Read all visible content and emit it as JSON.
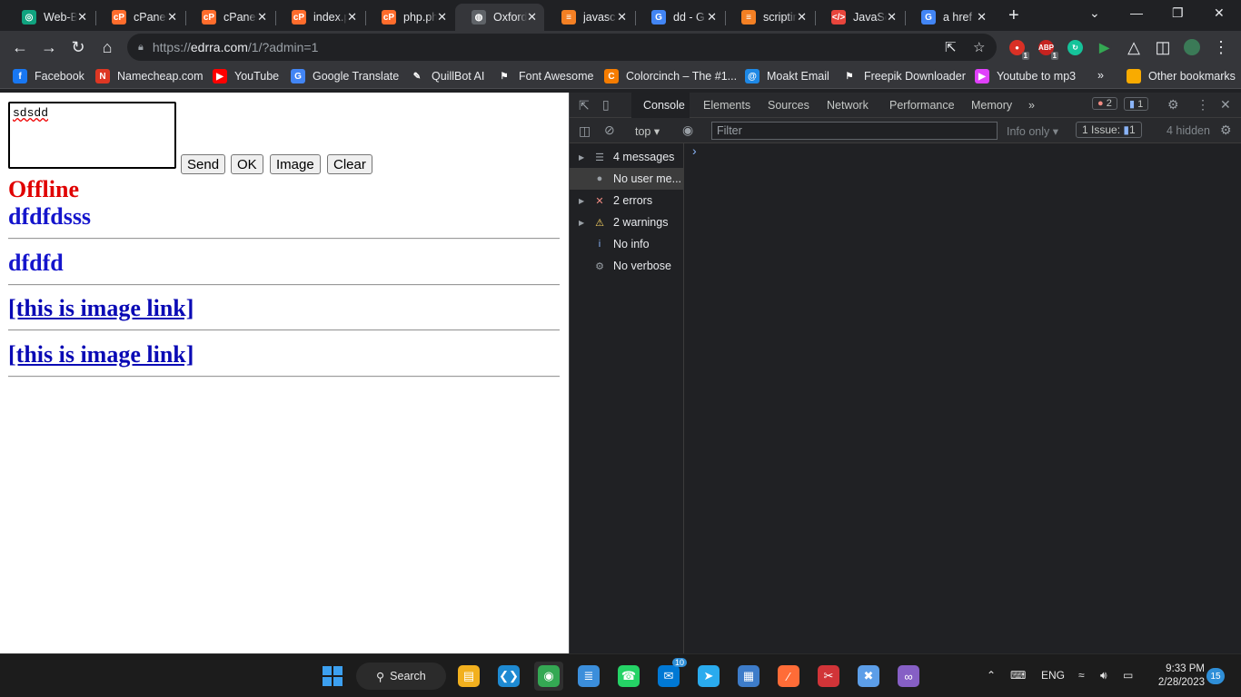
{
  "browser": {
    "tabs": [
      {
        "title": "Web-B",
        "favicon": "openai-favicon",
        "color": "#10a37f",
        "glyph": "◎"
      },
      {
        "title": "cPanel",
        "favicon": "cpanel-favicon",
        "color": "#ff6c2c",
        "glyph": "cP"
      },
      {
        "title": "cPanel",
        "favicon": "cpanel-favicon",
        "color": "#ff6c2c",
        "glyph": "cP"
      },
      {
        "title": "index.p",
        "favicon": "cpanel-favicon",
        "color": "#ff6c2c",
        "glyph": "cP"
      },
      {
        "title": "php.ph",
        "favicon": "cpanel-favicon",
        "color": "#ff6c2c",
        "glyph": "cP"
      },
      {
        "title": "Oxford",
        "favicon": "globe-favicon",
        "color": "#5f6368",
        "glyph": "◍"
      },
      {
        "title": "javasc",
        "favicon": "stackoverflow-favicon",
        "color": "#f48024",
        "glyph": "≡"
      },
      {
        "title": "dd - G",
        "favicon": "google-favicon",
        "color": "#4285f4",
        "glyph": "G"
      },
      {
        "title": "scriptin",
        "favicon": "stackoverflow-favicon",
        "color": "#f48024",
        "glyph": "≡"
      },
      {
        "title": "JavaSc",
        "favicon": "code-favicon",
        "color": "#e8453c",
        "glyph": "</>"
      },
      {
        "title": "a href",
        "favicon": "google-favicon",
        "color": "#4285f4",
        "glyph": "G"
      }
    ],
    "active_tab": 5,
    "url_prefix": "https://",
    "url_host": "edrra.com",
    "url_path": "/1/?admin=1",
    "extensions": [
      {
        "name": "extension-red-icon",
        "color": "#d93025",
        "glyph": "●",
        "badge": "1"
      },
      {
        "name": "adblock-icon",
        "color": "#c5221f",
        "glyph": "ABP",
        "badge": "1"
      },
      {
        "name": "grammarly-icon",
        "color": "#15c39a",
        "glyph": "↻",
        "badge": ""
      },
      {
        "name": "send-extension-icon",
        "color": "#35363a",
        "glyph": "▶",
        "badge": ""
      }
    ],
    "bookmarks": [
      {
        "label": "Facebook",
        "icon": "facebook-icon",
        "color": "#1877f2",
        "glyph": "f"
      },
      {
        "label": "Namecheap.com",
        "icon": "namecheap-icon",
        "color": "#de3723",
        "glyph": "N"
      },
      {
        "label": "YouTube",
        "icon": "youtube-icon",
        "color": "#ff0000",
        "glyph": "▶"
      },
      {
        "label": "Google Translate",
        "icon": "google-translate-icon",
        "color": "#4285f4",
        "glyph": "G"
      },
      {
        "label": "QuillBot AI",
        "icon": "quillbot-icon",
        "color": "#35363a",
        "glyph": "✎"
      },
      {
        "label": "Font Awesome",
        "icon": "flag-icon",
        "color": "#35363a",
        "glyph": "⚑"
      },
      {
        "label": "Colorcinch – The #1...",
        "icon": "colorcinch-icon",
        "color": "#f57c00",
        "glyph": "C"
      },
      {
        "label": "Moakt Email",
        "icon": "moakt-icon",
        "color": "#1e88e5",
        "glyph": "@"
      },
      {
        "label": "Freepik Downloader",
        "icon": "freepik-icon",
        "color": "#35363a",
        "glyph": "⚑"
      },
      {
        "label": "Youtube to mp3",
        "icon": "yt-mp3-icon",
        "color": "#e040fb",
        "glyph": "▶"
      }
    ],
    "overflow": "»",
    "other_bookmarks": "Other bookmarks"
  },
  "page": {
    "textarea_value": "sdsdd",
    "buttons": {
      "send": "Send",
      "ok": "OK",
      "image": "Image",
      "clear": "Clear"
    },
    "status": "Offline",
    "posts": [
      "dfdfdsss",
      "dfdfd"
    ],
    "links": [
      "[this is image link]",
      "[this is image link]"
    ]
  },
  "devtools": {
    "tabs": [
      "Console",
      "Elements",
      "Sources",
      "Network",
      "Performance",
      "Memory"
    ],
    "more": "»",
    "errors_badge": "2",
    "issues_badge": "1",
    "context": "top",
    "filter_placeholder": "Filter",
    "levels": "Info only",
    "issues_label": "1 Issue:",
    "issues_count": "1",
    "hidden": "4 hidden",
    "prompt": "›",
    "sidebar": [
      {
        "label": "4 messages",
        "icon": "list-icon",
        "glyph": "☰",
        "color": "#9aa0a6",
        "expandable": true
      },
      {
        "label": "No user me...",
        "icon": "user-icon",
        "glyph": "●",
        "color": "#9aa0a6",
        "expandable": false
      },
      {
        "label": "2 errors",
        "icon": "error-icon",
        "glyph": "✕",
        "color": "#f28b82",
        "expandable": true
      },
      {
        "label": "2 warnings",
        "icon": "warning-icon",
        "glyph": "⚠",
        "color": "#fdd663",
        "expandable": true
      },
      {
        "label": "No info",
        "icon": "info-icon",
        "glyph": "i",
        "color": "#8ab4f8",
        "expandable": false
      },
      {
        "label": "No verbose",
        "icon": "bug-icon",
        "glyph": "⚙",
        "color": "#9aa0a6",
        "expandable": false
      }
    ],
    "selected_sidebar": 1
  },
  "taskbar": {
    "search_label": "Search",
    "apps": [
      {
        "name": "file-explorer-icon",
        "color": "#f2b01e",
        "glyph": "▤"
      },
      {
        "name": "vscode-icon",
        "color": "#1e8ad2",
        "glyph": "❮❯"
      },
      {
        "name": "chrome-icon",
        "color": "#34a853",
        "glyph": "◉"
      },
      {
        "name": "notepad-icon",
        "color": "#3b8edb",
        "glyph": "≣"
      },
      {
        "name": "whatsapp-icon",
        "color": "#25d366",
        "glyph": "☎"
      },
      {
        "name": "mail-icon",
        "color": "#0078d4",
        "glyph": "✉",
        "badge": "10"
      },
      {
        "name": "telegram-icon",
        "color": "#2aabee",
        "glyph": "➤"
      },
      {
        "name": "store-icon",
        "color": "#3d7cc9",
        "glyph": "▦"
      },
      {
        "name": "postman-icon",
        "color": "#ff6c37",
        "glyph": "∕"
      },
      {
        "name": "snipping-icon",
        "color": "#d13438",
        "glyph": "✂"
      },
      {
        "name": "mailbox-icon",
        "color": "#5c9ee8",
        "glyph": "✖"
      },
      {
        "name": "visual-studio-icon",
        "color": "#865fc5",
        "glyph": "∞"
      }
    ],
    "language": "ENG",
    "time": "9:33 PM",
    "date": "2/28/2023",
    "notifications": "15"
  }
}
